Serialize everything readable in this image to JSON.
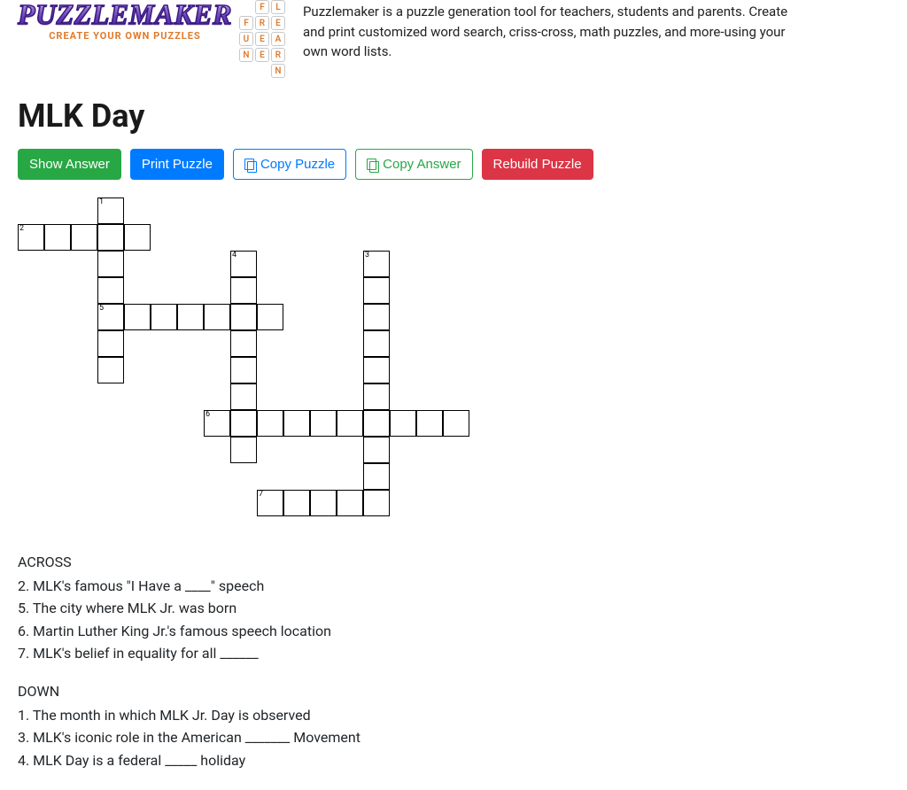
{
  "header": {
    "logo_title": "PUZZLEMAKER",
    "logo_subtitle": "CREATE YOUR OWN PUZZLES",
    "mini_grid": {
      "fun": [
        "F",
        "U",
        "N"
      ],
      "free": [
        "F",
        "R",
        "E",
        "E"
      ],
      "learn": [
        "L",
        "E",
        "A",
        "R",
        "N"
      ]
    },
    "description": "Puzzlemaker is a puzzle generation tool for teachers, students and parents. Create and print customized word search, criss-cross, math puzzles, and more-using your own word lists."
  },
  "page_title": "MLK Day",
  "toolbar": {
    "show_answer": "Show Answer",
    "print_puzzle": "Print Puzzle",
    "copy_puzzle": "Copy Puzzle",
    "copy_answer": "Copy Answer",
    "rebuild_puzzle": "Rebuild Puzzle"
  },
  "crossword": {
    "cell_size": 30,
    "cells": [
      {
        "r": 0,
        "c": 3,
        "n": "1"
      },
      {
        "r": 1,
        "c": 0,
        "n": "2"
      },
      {
        "r": 1,
        "c": 1
      },
      {
        "r": 1,
        "c": 2
      },
      {
        "r": 1,
        "c": 3
      },
      {
        "r": 1,
        "c": 4
      },
      {
        "r": 2,
        "c": 3
      },
      {
        "r": 2,
        "c": 13,
        "n": "3"
      },
      {
        "r": 2,
        "c": 8,
        "n": "4"
      },
      {
        "r": 3,
        "c": 3
      },
      {
        "r": 3,
        "c": 8
      },
      {
        "r": 3,
        "c": 13
      },
      {
        "r": 4,
        "c": 3,
        "n": "5"
      },
      {
        "r": 4,
        "c": 4
      },
      {
        "r": 4,
        "c": 5
      },
      {
        "r": 4,
        "c": 6
      },
      {
        "r": 4,
        "c": 7
      },
      {
        "r": 4,
        "c": 8
      },
      {
        "r": 4,
        "c": 9
      },
      {
        "r": 4,
        "c": 13
      },
      {
        "r": 5,
        "c": 3
      },
      {
        "r": 5,
        "c": 8
      },
      {
        "r": 5,
        "c": 13
      },
      {
        "r": 6,
        "c": 3
      },
      {
        "r": 6,
        "c": 8
      },
      {
        "r": 6,
        "c": 13
      },
      {
        "r": 7,
        "c": 8
      },
      {
        "r": 7,
        "c": 13
      },
      {
        "r": 8,
        "c": 7,
        "n": "6"
      },
      {
        "r": 8,
        "c": 8
      },
      {
        "r": 8,
        "c": 9
      },
      {
        "r": 8,
        "c": 10
      },
      {
        "r": 8,
        "c": 11
      },
      {
        "r": 8,
        "c": 12
      },
      {
        "r": 8,
        "c": 13
      },
      {
        "r": 8,
        "c": 14
      },
      {
        "r": 8,
        "c": 15
      },
      {
        "r": 8,
        "c": 16
      },
      {
        "r": 9,
        "c": 8
      },
      {
        "r": 9,
        "c": 13
      },
      {
        "r": 10,
        "c": 13
      },
      {
        "r": 11,
        "c": 9,
        "n": "7"
      },
      {
        "r": 11,
        "c": 10
      },
      {
        "r": 11,
        "c": 11
      },
      {
        "r": 11,
        "c": 12
      },
      {
        "r": 11,
        "c": 13
      }
    ]
  },
  "clues": {
    "across_heading": "ACROSS",
    "across": [
      "2. MLK's famous \"I Have a ____\" speech",
      "5. The city where MLK Jr. was born",
      "6. Martin Luther King Jr.'s famous speech location",
      "7. MLK's belief in equality for all ______"
    ],
    "down_heading": "DOWN",
    "down": [
      "1. The month in which MLK Jr. Day is observed",
      "3. MLK's iconic role in the American _______ Movement",
      "4. MLK Day is a federal _____ holiday"
    ]
  }
}
